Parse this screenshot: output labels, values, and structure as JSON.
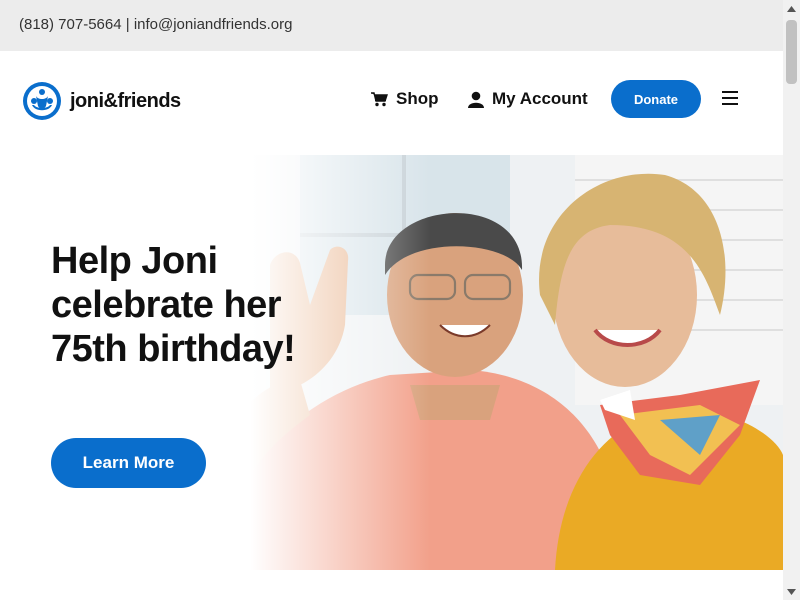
{
  "topbar": {
    "phone": "(818) 707-5664",
    "separator": " | ",
    "email": "info@joniandfriends.org"
  },
  "header": {
    "logo_text": "joni&friends",
    "logo_icon": "joni-and-friends-logo-icon",
    "nav": {
      "shop_label": "Shop",
      "shop_icon": "cart-icon",
      "account_label": "My Account",
      "account_icon": "user-icon",
      "donate_label": "Donate",
      "menu_icon": "hamburger-menu-icon"
    }
  },
  "hero": {
    "title": "Help Joni celebrate her 75th birthday!",
    "cta_label": "Learn More",
    "image_alt": "smiling couple"
  },
  "colors": {
    "accent": "#0a6ecc",
    "topbar_bg": "#ececec",
    "text": "#111111"
  }
}
